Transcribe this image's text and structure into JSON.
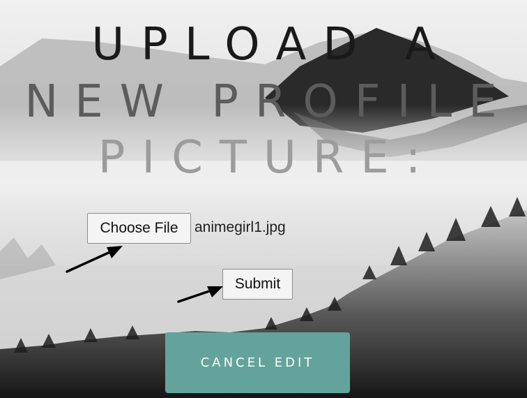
{
  "page": {
    "title_lines": [
      "UPLOAD A",
      "NEW PROFILE",
      "PICTURE:"
    ]
  },
  "upload_form": {
    "choose_file_label": "Choose File",
    "file_name": "animegirl1.jpg",
    "submit_label": "Submit"
  },
  "actions": {
    "cancel_label": "CANCEL EDIT"
  },
  "icons": {
    "arrow_to_choose_file": "arrow-icon",
    "arrow_to_submit": "arrow-icon"
  },
  "colors": {
    "cancel_button_bg": "#64a39b",
    "cancel_button_text": "#ffffff"
  }
}
